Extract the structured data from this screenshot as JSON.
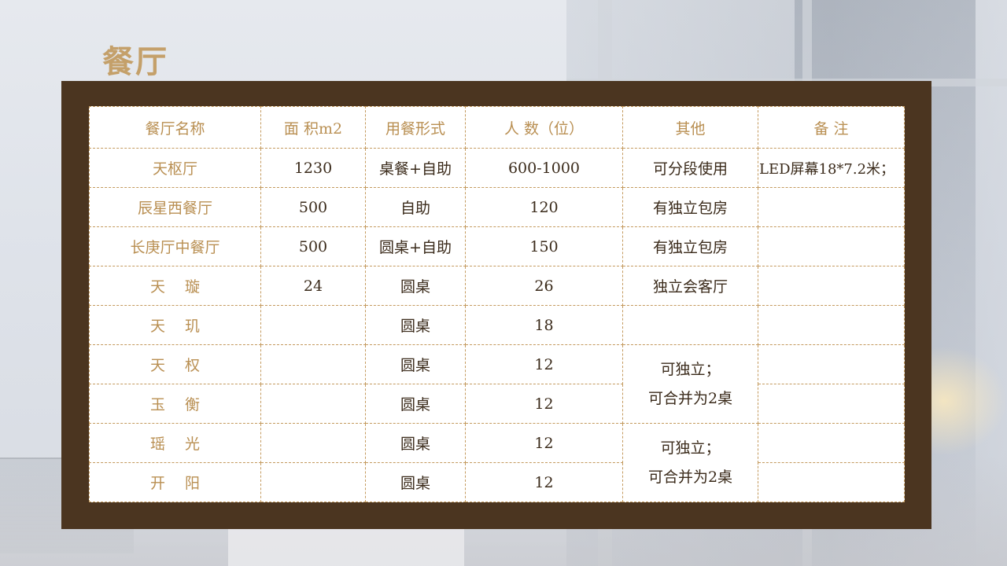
{
  "page": {
    "title": "餐厅"
  },
  "table": {
    "headers": [
      "餐厅名称",
      "面 积m2",
      "用餐形式",
      "人 数（位）",
      "其他",
      "备 注"
    ],
    "rows": [
      {
        "name": "天枢厅",
        "area": "1230",
        "style": "桌餐+自助",
        "people": "600-1000",
        "other": "可分段使用",
        "note": "LED屏幕18*7.2米；"
      },
      {
        "name": "辰星西餐厅",
        "area": "500",
        "style": "自助",
        "people": "120",
        "other": "有独立包房",
        "note": ""
      },
      {
        "name": "长庚厅中餐厅",
        "area": "500",
        "style": "圆桌+自助",
        "people": "150",
        "other": "有独立包房",
        "note": ""
      },
      {
        "name": "天　 璇",
        "area": "24",
        "style": "圆桌",
        "people": "26",
        "other": "独立会客厅",
        "note": ""
      },
      {
        "name": "天　 玑",
        "area": "",
        "style": "圆桌",
        "people": "18",
        "other": "",
        "note": ""
      },
      {
        "name": "天　 权",
        "area": "",
        "style": "圆桌",
        "people": "12",
        "note": ""
      },
      {
        "name": "玉　 衡",
        "area": "",
        "style": "圆桌",
        "people": "12",
        "note": ""
      },
      {
        "name": "瑶　 光",
        "area": "",
        "style": "圆桌",
        "people": "12",
        "note": ""
      },
      {
        "name": "开　 阳",
        "area": "",
        "style": "圆桌",
        "people": "12",
        "note": ""
      }
    ],
    "merged_other_1": {
      "line1": "可独立；",
      "line2": "可合并为2桌"
    },
    "merged_other_2": {
      "line1": "可独立；",
      "line2": "可合并为2桌"
    }
  },
  "colors": {
    "title": "#c4a06a",
    "frame": "#4b3520",
    "border": "#c49a5e",
    "header_text": "#b98f52"
  }
}
